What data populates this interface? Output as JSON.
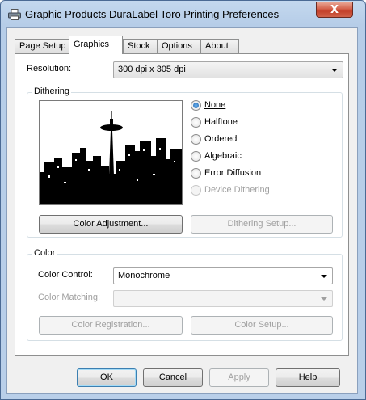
{
  "window": {
    "title": "Graphic Products DuraLabel Toro Printing Preferences",
    "close_glyph": "X"
  },
  "tabs": [
    {
      "label": "Page Setup",
      "mnemonic_index": 1,
      "active": false
    },
    {
      "label": "Graphics",
      "active": true
    },
    {
      "label": "Stock",
      "active": false
    },
    {
      "label": "Options",
      "active": false
    },
    {
      "label": "About",
      "active": false
    }
  ],
  "resolution": {
    "label": "Resolution:",
    "value": "300 dpi x 305 dpi"
  },
  "dithering": {
    "group_label": "Dithering",
    "options": [
      {
        "label": "None",
        "checked": true,
        "disabled": false
      },
      {
        "label": "Halftone",
        "checked": false,
        "disabled": false
      },
      {
        "label": "Ordered",
        "checked": false,
        "disabled": false
      },
      {
        "label": "Algebraic",
        "checked": false,
        "disabled": false
      },
      {
        "label": "Error Diffusion",
        "checked": false,
        "disabled": false
      },
      {
        "label": "Device Dithering",
        "checked": false,
        "disabled": true
      }
    ],
    "color_adjustment_button": "Color Adjustment...",
    "dithering_setup_button": "Dithering Setup..."
  },
  "color": {
    "group_label": "Color",
    "control_label": "Color Control:",
    "control_value": "Monochrome",
    "matching_label": "Color Matching:",
    "matching_value": "",
    "registration_button": "Color Registration...",
    "setup_button": "Color Setup..."
  },
  "buttons": {
    "ok": "OK",
    "cancel": "Cancel",
    "apply": "Apply",
    "help": "Help"
  },
  "colors": {
    "title_bar": "#b9cfe9",
    "close_button": "#c23d27",
    "radio_accent": "#1c5fa8"
  }
}
